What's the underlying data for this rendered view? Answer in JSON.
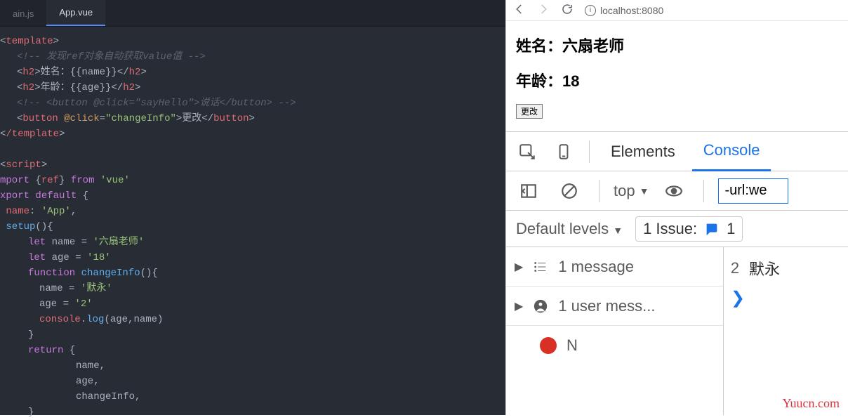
{
  "editor": {
    "tabs": [
      {
        "label": "ain.js"
      },
      {
        "label": "App.vue"
      }
    ],
    "code": {
      "template_open": "template",
      "comment1": "<!-- 发现ref对象自动获取value值 -->",
      "h2_name_open": "h2",
      "h2_name_text": ">姓名：{{name}}</",
      "h2_name_close": "h2",
      "h2_age_open": "h2",
      "h2_age_text": ">年龄：{{age}}</",
      "h2_age_close": "h2",
      "comment2": "<!-- <button @click=\"sayHello\">说话</button> -->",
      "btn_tag": "button",
      "btn_attr": "@click",
      "btn_val": "\"changeInfo\"",
      "btn_inner": "更改",
      "template_close": "/template",
      "script_open": "script",
      "import_kw": "mport",
      "import_b1": " {",
      "import_ref": "ref",
      "import_b2": "} ",
      "from_kw": "from",
      "vue_str": " 'vue'",
      "export_kw": "xport",
      "default_kw": " default",
      "brace_open": " {",
      "name_key": "name",
      "colon": ": ",
      "app_str": "'App'",
      "comma": ",",
      "setup": "setup",
      "setup_parens": "(){",
      "let1": "let",
      "name_var": " name ",
      "eq": "= ",
      "name_str": "'六扇老师'",
      "let2": "let",
      "age_var": " age ",
      "age_str": "'18'",
      "func_kw": "function",
      "func_name": " changeInfo",
      "func_paren": "(){",
      "assign_name": "name ",
      "assign_name_val": "'默永'",
      "assign_age": "age ",
      "assign_age_val": "'2'",
      "console_obj": "console",
      "dot": ".",
      "log_fn": "log",
      "log_args": "(age,name)",
      "cb1": "}",
      "return_kw": "return",
      "return_brace": " {",
      "ret_name": "name,",
      "ret_age": "age,",
      "ret_ci": "changeInfo,",
      "cb2": "}"
    }
  },
  "browser": {
    "url": "localhost:8080",
    "h_name_label": "姓名：",
    "h_name_val": "六扇老师",
    "h_age_label": "年龄：",
    "h_age_val": "18",
    "btn": "更改"
  },
  "devtools": {
    "tab_elements": "Elements",
    "tab_console": "Console",
    "top_label": "top",
    "filter_value": "-url:we",
    "levels": "Default levels",
    "issues_label": "1 Issue:",
    "issues_count": "1",
    "sb_messages": "1 message",
    "sb_user": "1 user mess...",
    "sb_n": "N",
    "log_count": "2",
    "log_text": "默永",
    "watermark": "Yuucn.com"
  }
}
